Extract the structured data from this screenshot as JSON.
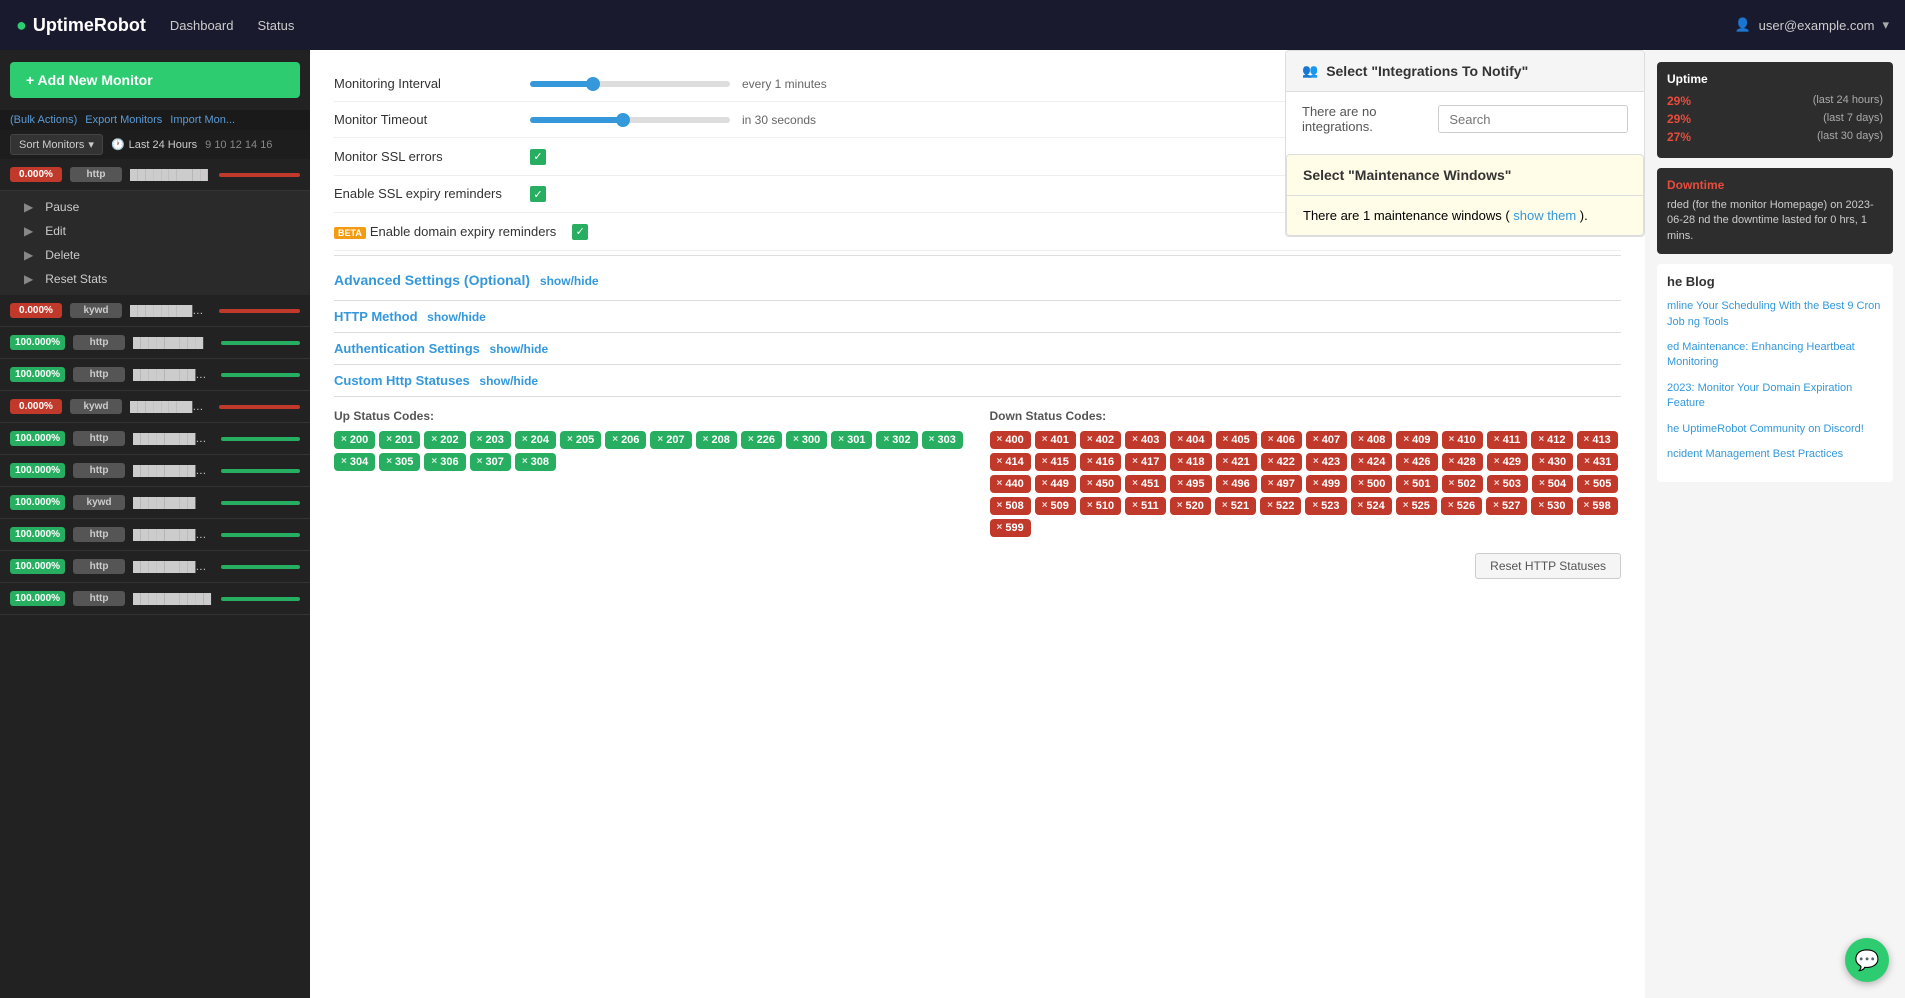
{
  "nav": {
    "logo": "UptimeRobot",
    "logo_dot": "●",
    "links": [
      "Dashboard",
      "Status"
    ],
    "user_label": "user@example.com"
  },
  "sidebar": {
    "add_monitor_label": "+ Add New Monitor",
    "bulk_actions": "(Bulk Actions)",
    "export_monitors": "Export Monitors",
    "import_monitors": "Import Mon...",
    "sort_label": "Sort Monitors",
    "time_filter": "Last 24 Hours",
    "time_nums": "9  10  12  14  16",
    "monitors": [
      {
        "pct": "0.000%",
        "type": "http",
        "name": "██████████",
        "status": "red"
      },
      {
        "pct": "0.000%",
        "type": "kywd",
        "name": "████████████████",
        "status": "red"
      },
      {
        "pct": "100.000%",
        "type": "http",
        "name": "█████████",
        "status": "green"
      },
      {
        "pct": "100.000%",
        "type": "http",
        "name": "███████████",
        "status": "green"
      },
      {
        "pct": "0.000%",
        "type": "kywd",
        "name": "████████████████████",
        "status": "red"
      },
      {
        "pct": "100.000%",
        "type": "http",
        "name": "██████████████",
        "status": "green"
      },
      {
        "pct": "100.000%",
        "type": "http",
        "name": "██████████████",
        "status": "green"
      },
      {
        "pct": "100.000%",
        "type": "kywd",
        "name": "████████",
        "status": "green"
      },
      {
        "pct": "100.000%",
        "type": "http",
        "name": "████████████",
        "status": "green"
      },
      {
        "pct": "100.000%",
        "type": "http",
        "name": "███████████",
        "status": "green"
      },
      {
        "pct": "100.000%",
        "type": "http",
        "name": "██████████",
        "status": "green"
      }
    ],
    "context_menu": [
      "Pause",
      "Edit",
      "Delete",
      "Reset Stats"
    ]
  },
  "right_panel": {
    "uptime_title": "Uptime",
    "uptime_rows": [
      {
        "pct": "29%",
        "label": "(last 24 hours)",
        "color": "red"
      },
      {
        "pct": "29%",
        "label": "(last 7 days)",
        "color": "red"
      },
      {
        "pct": "27%",
        "label": "(last 30 days)",
        "color": "red"
      }
    ],
    "downtime_title": "Downtime",
    "downtime_text": "rded (for the monitor Homepage) on 2023-06-28 nd the downtime lasted for 0 hrs, 1 mins.",
    "blog_title": "he Blog",
    "blog_links": [
      "mline Your Scheduling With the Best 9 Cron Job ng Tools",
      "ed Maintenance: Enhancing Heartbeat Monitoring",
      "2023: Monitor Your Domain Expiration Feature",
      "he UptimeRobot Community on Discord!",
      "ncident Management Best Practices"
    ]
  },
  "form": {
    "monitoring_interval_label": "Monitoring Interval",
    "monitoring_interval_value": "every 1 minutes",
    "monitor_timeout_label": "Monitor Timeout",
    "monitor_timeout_value": "in 30 seconds",
    "ssl_errors_label": "Monitor SSL errors",
    "ssl_expiry_label": "Enable SSL expiry reminders",
    "domain_expiry_label": "Enable domain expiry reminders",
    "domain_expiry_beta": "BETA",
    "advanced_settings_label": "Advanced Settings (Optional)",
    "show_hide": "show/hide",
    "http_method_label": "HTTP Method",
    "http_method_show_hide": "show/hide",
    "auth_settings_label": "Authentication Settings",
    "auth_settings_show_hide": "show/hide",
    "custom_http_label": "Custom Http Statuses",
    "custom_http_show_hide": "show/hide",
    "up_codes_label": "Up Status Codes:",
    "down_codes_label": "Down Status Codes:",
    "up_codes": [
      "200",
      "201",
      "202",
      "203",
      "204",
      "205",
      "206",
      "207",
      "208",
      "226",
      "300",
      "301",
      "302",
      "303",
      "304",
      "305",
      "306",
      "307",
      "308"
    ],
    "down_codes": [
      "400",
      "401",
      "402",
      "403",
      "404",
      "405",
      "406",
      "407",
      "408",
      "409",
      "410",
      "411",
      "412",
      "413",
      "414",
      "415",
      "416",
      "417",
      "418",
      "421",
      "422",
      "423",
      "424",
      "426",
      "428",
      "429",
      "430",
      "431",
      "440",
      "449",
      "450",
      "451",
      "495",
      "496",
      "497",
      "499",
      "500",
      "501",
      "502",
      "503",
      "504",
      "505",
      "508",
      "509",
      "510",
      "511",
      "520",
      "521",
      "522",
      "523",
      "524",
      "525",
      "526",
      "527",
      "530",
      "598",
      "599"
    ],
    "reset_btn_label": "Reset HTTP Statuses"
  },
  "integrations": {
    "title": "Select \"Integrations To Notify\"",
    "no_integrations": "There are no integrations.",
    "search_placeholder": "Search",
    "search_btn": "🔍"
  },
  "maintenance": {
    "title": "Select \"Maintenance Windows\"",
    "text_prefix": "There are 1 maintenance windows ( ",
    "show_them": "show them",
    "text_suffix": " )."
  },
  "chat": {
    "icon": "💬"
  }
}
